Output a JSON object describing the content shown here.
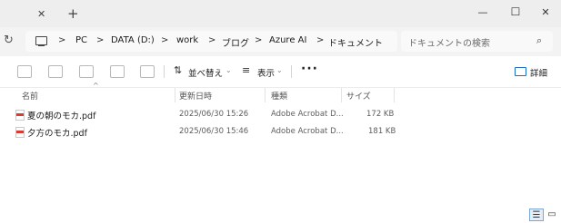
{
  "window": {
    "tab_close": "✕",
    "new_tab": "+",
    "minimize": "—",
    "maximize": "☐",
    "close": "✕"
  },
  "address": {
    "refresh": "↻",
    "crumbs": [
      "PC",
      "DATA (D:)",
      "work",
      "ブログ",
      "Azure AI",
      "ドキュメント"
    ],
    "separator": ">",
    "search_placeholder": "ドキュメントの検索",
    "search_glyph": "⌕"
  },
  "toolbar": {
    "sort_icon": "⇅",
    "sort_label": "並べ替え",
    "view_icon": "≡",
    "view_label": "表示",
    "more": "···",
    "details_label": "詳細"
  },
  "columns": {
    "sort_caret": "^",
    "name": "名前",
    "modified": "更新日時",
    "type": "種類",
    "size": "サイズ"
  },
  "files": [
    {
      "name": "夏の朝のモカ.pdf",
      "modified": "2025/06/30 15:26",
      "type": "Adobe Acrobat D...",
      "size": "172 KB"
    },
    {
      "name": "夕方のモカ.pdf",
      "modified": "2025/06/30 15:46",
      "type": "Adobe Acrobat D...",
      "size": "181 KB"
    }
  ],
  "statusbar": {
    "details_view": "☰",
    "tiles_view": "▭"
  }
}
